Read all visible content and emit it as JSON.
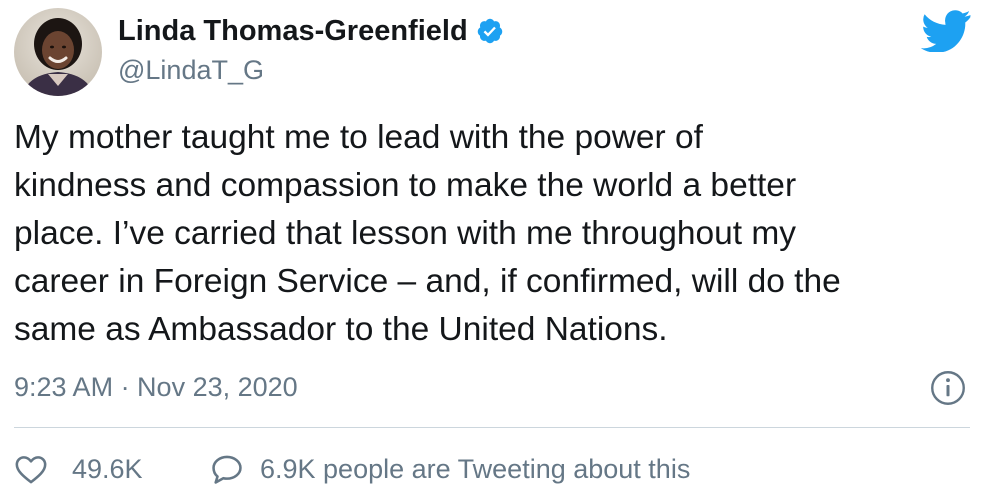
{
  "author": {
    "display_name": "Linda Thomas-Greenfield",
    "handle": "@LindaT_G",
    "verified": true,
    "avatar_icon": "profile-photo"
  },
  "tweet": {
    "text": "My mother taught me to lead with the power of\nkindness and compassion to make the world a better\nplace. I’ve carried that lesson with me throughout my\ncareer in Foreign Service – and, if confirmed, will do the\nsame as Ambassador to the United Nations.",
    "timestamp": "9:23 AM · Nov 23, 2020"
  },
  "actions": {
    "like_count": "49.6K",
    "conversation_label": "6.9K people are Tweeting about this"
  },
  "icons": {
    "brand": "twitter-bird-icon",
    "verified": "verified-badge-icon",
    "info": "info-icon",
    "like": "heart-icon",
    "reply": "speech-bubble-icon"
  },
  "colors": {
    "brand_blue": "#1da1f2",
    "text_primary": "#14171a",
    "text_secondary": "#657786",
    "divider": "#ccd6dd"
  }
}
